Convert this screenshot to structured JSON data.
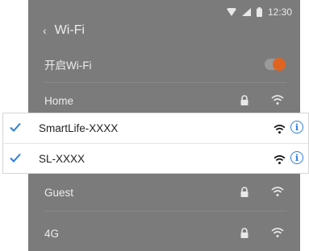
{
  "status_bar": {
    "time": "12:30"
  },
  "header": {
    "title": "Wi-Fi",
    "back_icon": "chevron-left-icon"
  },
  "wifi_toggle": {
    "label": "开启Wi-Fi",
    "on": true,
    "accent": "#e0631f"
  },
  "networks_above": [
    {
      "name": "Home",
      "locked": true
    }
  ],
  "popup_networks": [
    {
      "name": "SmartLife-XXXX",
      "checked": true
    },
    {
      "name": "SL-XXXX",
      "checked": true
    }
  ],
  "networks_below": [
    {
      "name": "Guest",
      "locked": true
    },
    {
      "name": "4G",
      "locked": true
    }
  ],
  "colors": {
    "check": "#2f7fd8",
    "info": "#2f7fd8",
    "overlay": "#7b7b7b"
  }
}
